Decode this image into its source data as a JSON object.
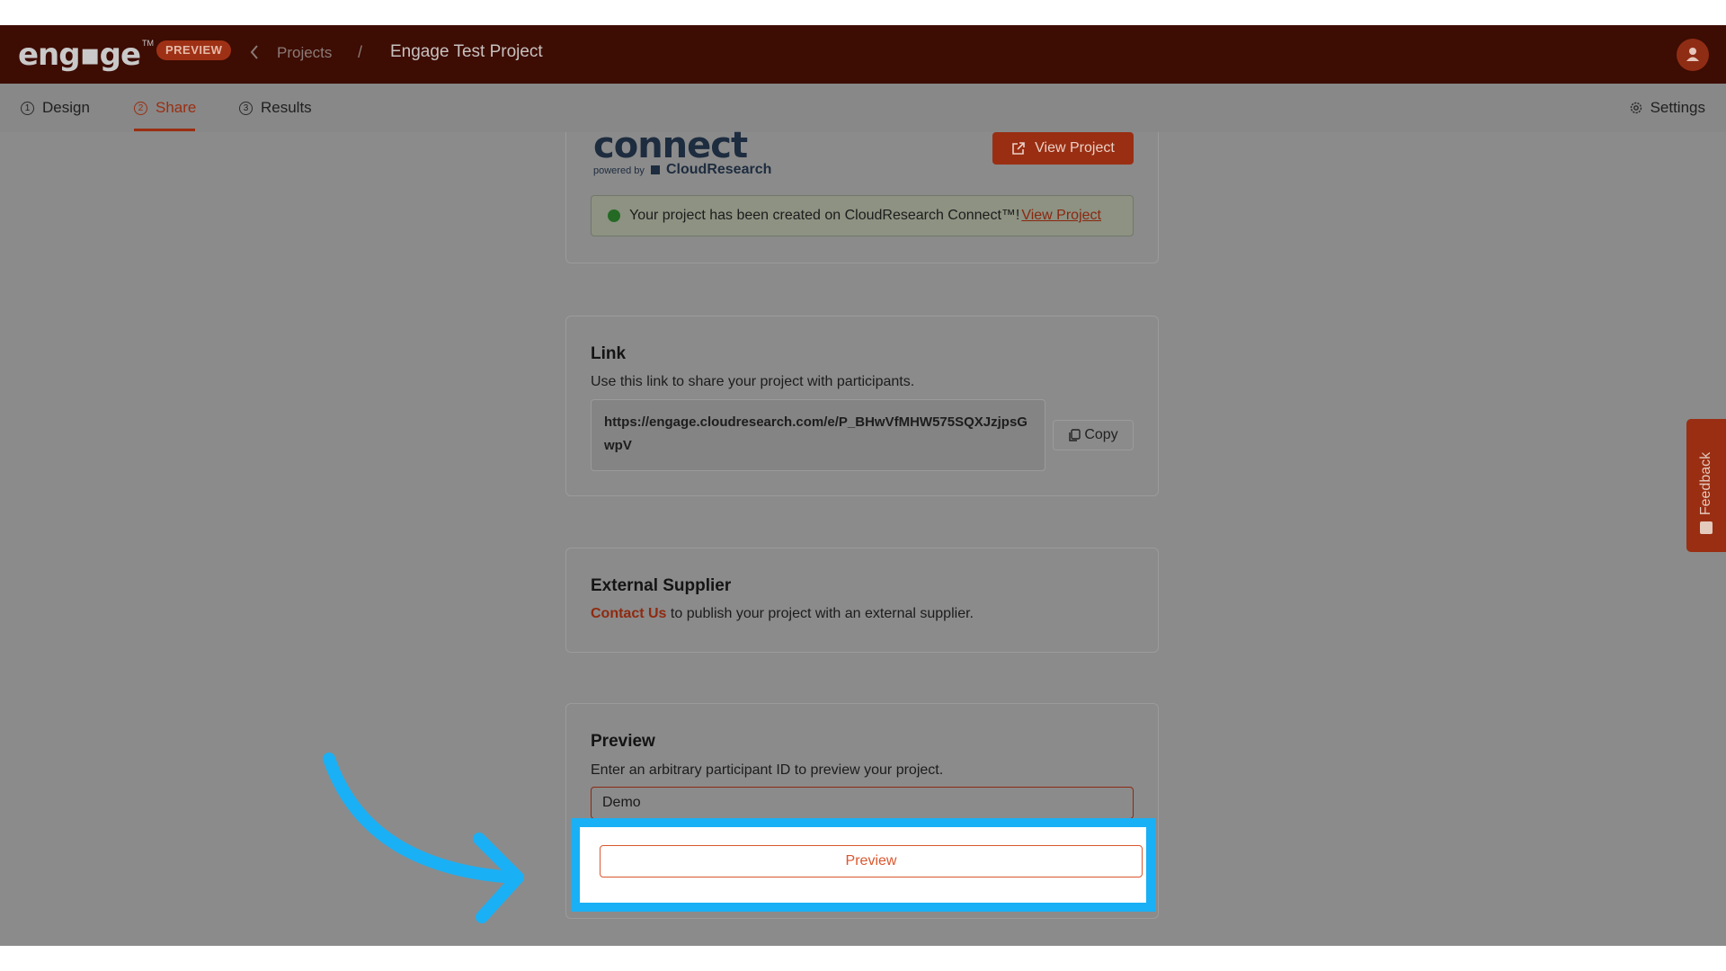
{
  "header": {
    "logo_text": "eng▪ge",
    "logo_tm": "TM",
    "preview_badge": "PREVIEW",
    "breadcrumb_projects": "Projects",
    "breadcrumb_separator": "/",
    "project_name": "Engage Test Project"
  },
  "tabs": [
    {
      "num": "1",
      "label": "Design"
    },
    {
      "num": "2",
      "label": "Share"
    },
    {
      "num": "3",
      "label": "Results"
    }
  ],
  "settings_label": "Settings",
  "connect": {
    "logo_word": "connect",
    "powered_by": "powered by",
    "brand": "CloudResearch",
    "view_project_button": "View Project",
    "success_message": "Your project has been created on CloudResearch Connect™!",
    "success_link": "View Project"
  },
  "link_card": {
    "title": "Link",
    "description": "Use this link to share your project with participants.",
    "url": "https://engage.cloudresearch.com/e/P_BHwVfMHW575SQXJzjpsGwpV",
    "copy_button": "Copy"
  },
  "supplier_card": {
    "title": "External Supplier",
    "contact_link": "Contact Us",
    "description_rest": " to publish your project with an external supplier."
  },
  "preview_card": {
    "title": "Preview",
    "description": "Enter an arbitrary participant ID to preview your project.",
    "input_value": "Demo",
    "button_label": "Preview"
  },
  "feedback_label": "Feedback",
  "colors": {
    "brand": "#9a2e12",
    "highlight": "#1ab0f5",
    "overlay": "#8b8b8b"
  }
}
